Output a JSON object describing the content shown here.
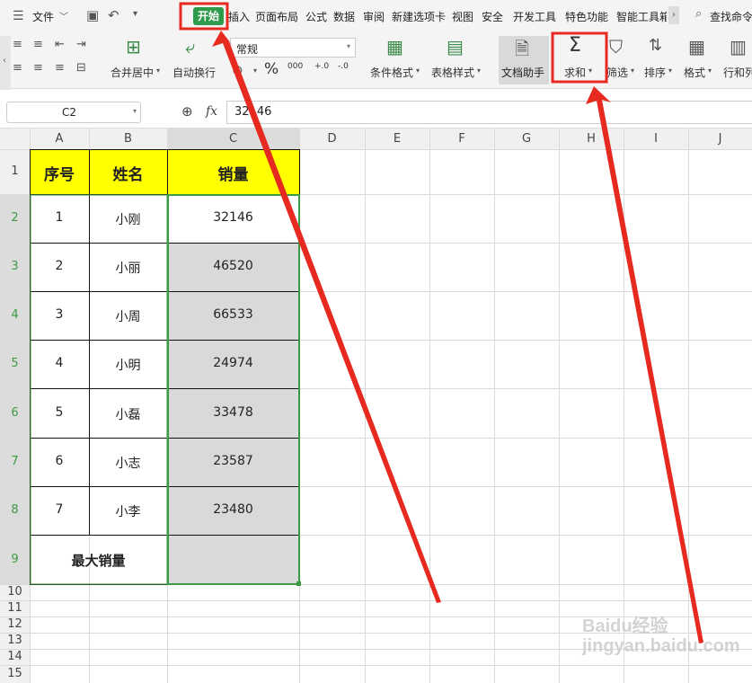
{
  "menu": {
    "file": "文件",
    "tabs": [
      "开始",
      "插入",
      "页面布局",
      "公式",
      "数据",
      "审阅",
      "新建选项卡",
      "视图",
      "安全",
      "开发工具",
      "特色功能",
      "智能工具箱"
    ],
    "search": "查找命令"
  },
  "ribbon": {
    "merge": "合并居中",
    "wrap": "自动换行",
    "number_format": "常规",
    "percent": "%",
    "thousands": "000",
    "inc_dec": "+.0",
    "dec_dec": "-.0",
    "cond_format": "条件格式",
    "table_style": "表格样式",
    "doc_helper": "文档助手",
    "sum": "求和",
    "filter": "筛选",
    "sort": "排序",
    "format": "格式",
    "rowcol": "行和列"
  },
  "formula": {
    "cell_ref": "C2",
    "fx": "fx",
    "value": "32146"
  },
  "columns": [
    "A",
    "B",
    "C",
    "D",
    "E",
    "F",
    "G",
    "H",
    "I",
    "J"
  ],
  "rows": [
    "1",
    "2",
    "3",
    "4",
    "5",
    "6",
    "7",
    "8",
    "9",
    "10",
    "11",
    "12",
    "13",
    "14",
    "15"
  ],
  "table": {
    "headers": [
      "序号",
      "姓名",
      "销量"
    ],
    "data": [
      [
        "1",
        "小刚",
        "32146"
      ],
      [
        "2",
        "小丽",
        "46520"
      ],
      [
        "3",
        "小周",
        "66533"
      ],
      [
        "4",
        "小明",
        "24974"
      ],
      [
        "5",
        "小磊",
        "33478"
      ],
      [
        "6",
        "小志",
        "23587"
      ],
      [
        "7",
        "小李",
        "23480"
      ]
    ],
    "footer": "最大销量"
  },
  "watermark": "Baidu经验 jingyan.baidu.com",
  "colors": {
    "header_fill": "#ffff00",
    "selection": "#3c9a44",
    "selected_fill": "#d9d9d9",
    "annotation": "#e62a1f",
    "accent_green": "#2e9b4a"
  }
}
